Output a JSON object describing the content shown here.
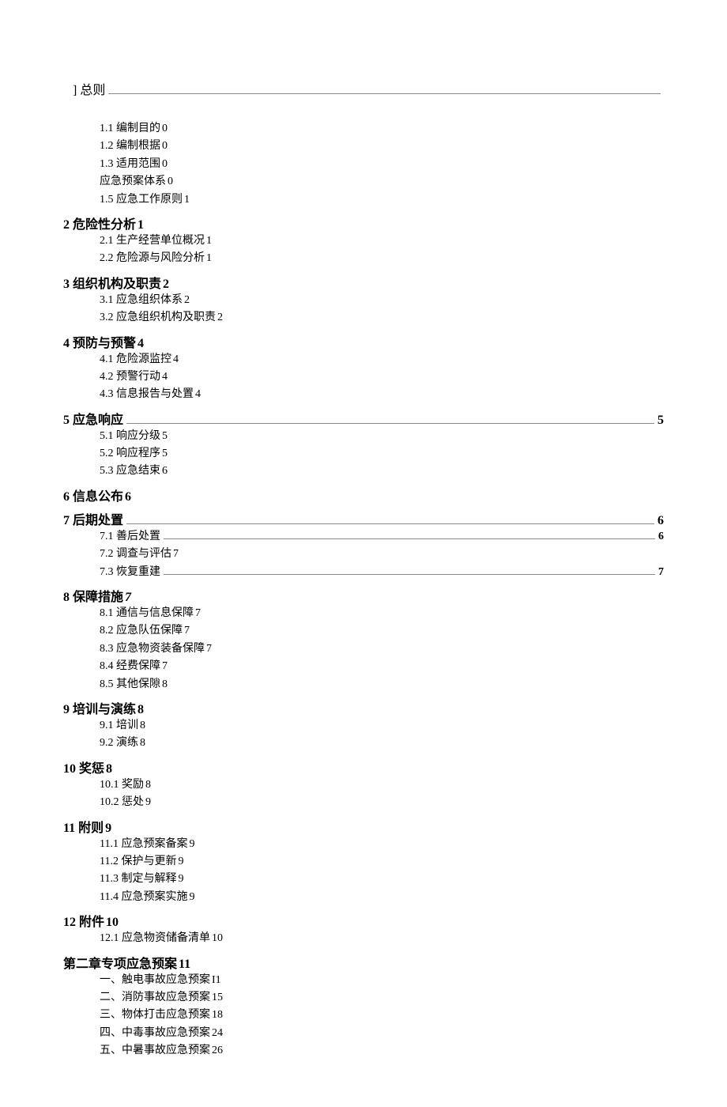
{
  "toc": {
    "top": {
      "label": "]  总则",
      "page": ""
    },
    "items": [
      {
        "type": "sub",
        "num": "1.1",
        "label": "编制目的",
        "page": "0",
        "leader": false
      },
      {
        "type": "sub",
        "num": "1.2",
        "label": "编制根据",
        "page": "0",
        "leader": false
      },
      {
        "type": "sub",
        "num": "1.3",
        "label": "适用范围",
        "page": "0",
        "leader": false
      },
      {
        "type": "sub",
        "num": "",
        "label": "应急预案体系",
        "page": "0",
        "leader": false
      },
      {
        "type": "sub",
        "num": "1.5",
        "label": "应急工作原则",
        "page": "1",
        "leader": false
      },
      {
        "type": "sec",
        "num": "2",
        "label": "危险性分析",
        "page": "1",
        "leader": false
      },
      {
        "type": "sub",
        "num": "2.1",
        "label": "生产经营单位概况",
        "page": "1",
        "leader": false
      },
      {
        "type": "sub",
        "num": "2.2",
        "label": "危险源与风险分析",
        "page": "1",
        "leader": false
      },
      {
        "type": "sec",
        "num": "3",
        "label": "组织机构及职责",
        "page": "2",
        "leader": false
      },
      {
        "type": "sub",
        "num": "3.1",
        "label": "应急组织体系",
        "page": "2",
        "leader": false
      },
      {
        "type": "sub",
        "num": "3.2",
        "label": "应急组织机构及职责",
        "page": "2",
        "leader": false
      },
      {
        "type": "sec",
        "num": "4",
        "label": "预防与预警",
        "page": "4",
        "leader": false
      },
      {
        "type": "sub",
        "num": "4.1",
        "label": "危险源监控",
        "page": "4",
        "leader": false
      },
      {
        "type": "sub",
        "num": "4.2",
        "label": "预警行动",
        "page": "4",
        "leader": false
      },
      {
        "type": "sub",
        "num": "4.3",
        "label": "信息报告与处置",
        "page": "4",
        "leader": false
      },
      {
        "type": "sec",
        "num": "5",
        "label": "应急响应",
        "page": "5",
        "leader": true
      },
      {
        "type": "sub",
        "num": "5.1",
        "label": "响应分级",
        "page": "5",
        "leader": false
      },
      {
        "type": "sub",
        "num": "5.2",
        "label": "响应程序",
        "page": "5",
        "leader": false
      },
      {
        "type": "sub",
        "num": "5.3",
        "label": "应急结束",
        "page": "6",
        "leader": false
      },
      {
        "type": "sec",
        "num": "6",
        "label": "信息公布",
        "page": "6",
        "leader": false
      },
      {
        "type": "sec",
        "num": "7",
        "label": "后期处置",
        "page": "6",
        "leader": true,
        "italic7": true
      },
      {
        "type": "sub",
        "num": "7.1",
        "label": "善后处置",
        "page": "6",
        "leader": true
      },
      {
        "type": "sub",
        "num": "7.2",
        "label": "调查与评估",
        "page": "7",
        "leader": false
      },
      {
        "type": "sub",
        "num": "7.3",
        "label": "恢复重建",
        "page": "7",
        "leader": true
      },
      {
        "type": "sec",
        "num": "8",
        "label": "保障措施",
        "page": "7",
        "leader": false,
        "italic7": true
      },
      {
        "type": "sub",
        "num": "8.1",
        "label": "通信与信息保障",
        "page": "7",
        "leader": false
      },
      {
        "type": "sub",
        "num": "8.2",
        "label": "应急队伍保障",
        "page": "7",
        "leader": false
      },
      {
        "type": "sub",
        "num": "8.3",
        "label": "应急物资装备保障",
        "page": "7",
        "leader": false
      },
      {
        "type": "sub",
        "num": "8.4",
        "label": "经费保障",
        "page": "7",
        "leader": false
      },
      {
        "type": "sub",
        "num": "8.5",
        "label": "其他保隙",
        "page": "8",
        "leader": false
      },
      {
        "type": "sec",
        "num": "9",
        "label": "培训与演练",
        "page": "8",
        "leader": false
      },
      {
        "type": "sub",
        "num": "9.1",
        "label": "培训",
        "page": "8",
        "leader": false
      },
      {
        "type": "sub",
        "num": "9.2",
        "label": "演练",
        "page": "8",
        "leader": false
      },
      {
        "type": "sec",
        "num": "10",
        "label": "奖惩",
        "page": "8",
        "leader": false
      },
      {
        "type": "sub",
        "num": "10.1",
        "label": "奖励",
        "page": "8",
        "leader": false
      },
      {
        "type": "sub",
        "num": "10.2",
        "label": "惩处",
        "page": "9",
        "leader": false
      },
      {
        "type": "sec",
        "num": "11",
        "label": "附则",
        "page": "9",
        "leader": false
      },
      {
        "type": "sub",
        "num": "11.1",
        "label": "应急预案备案",
        "page": "9",
        "leader": false
      },
      {
        "type": "sub",
        "num": "11.2",
        "label": "保护与更新",
        "page": "9",
        "leader": false
      },
      {
        "type": "sub",
        "num": "11.3",
        "label": "制定与解释",
        "page": "9",
        "leader": false
      },
      {
        "type": "sub",
        "num": "11.4",
        "label": "应急预案实施",
        "page": "9",
        "leader": false
      },
      {
        "type": "sec",
        "num": "12",
        "label": "附件",
        "page": "10",
        "leader": false
      },
      {
        "type": "sub",
        "num": "12.1",
        "label": "应急物资储备清单",
        "page": "10",
        "leader": false
      },
      {
        "type": "sec",
        "num": "",
        "label": "第二章专项应急预案",
        "page": "11",
        "leader": false,
        "nospecnum": true
      },
      {
        "type": "sub",
        "num": "",
        "label": "一、触电事故应急预案",
        "page": "I1",
        "leader": false
      },
      {
        "type": "sub",
        "num": "",
        "label": "二、消防事故应急预案",
        "page": "15",
        "leader": false
      },
      {
        "type": "sub",
        "num": "",
        "label": "三、物体打击应急预案",
        "page": "18",
        "leader": false
      },
      {
        "type": "sub",
        "num": "",
        "label": "四、中毒事故应急预案",
        "page": "24",
        "leader": false
      },
      {
        "type": "sub",
        "num": "",
        "label": "五、中暑事故应急预案",
        "page": "26",
        "leader": false
      }
    ]
  }
}
